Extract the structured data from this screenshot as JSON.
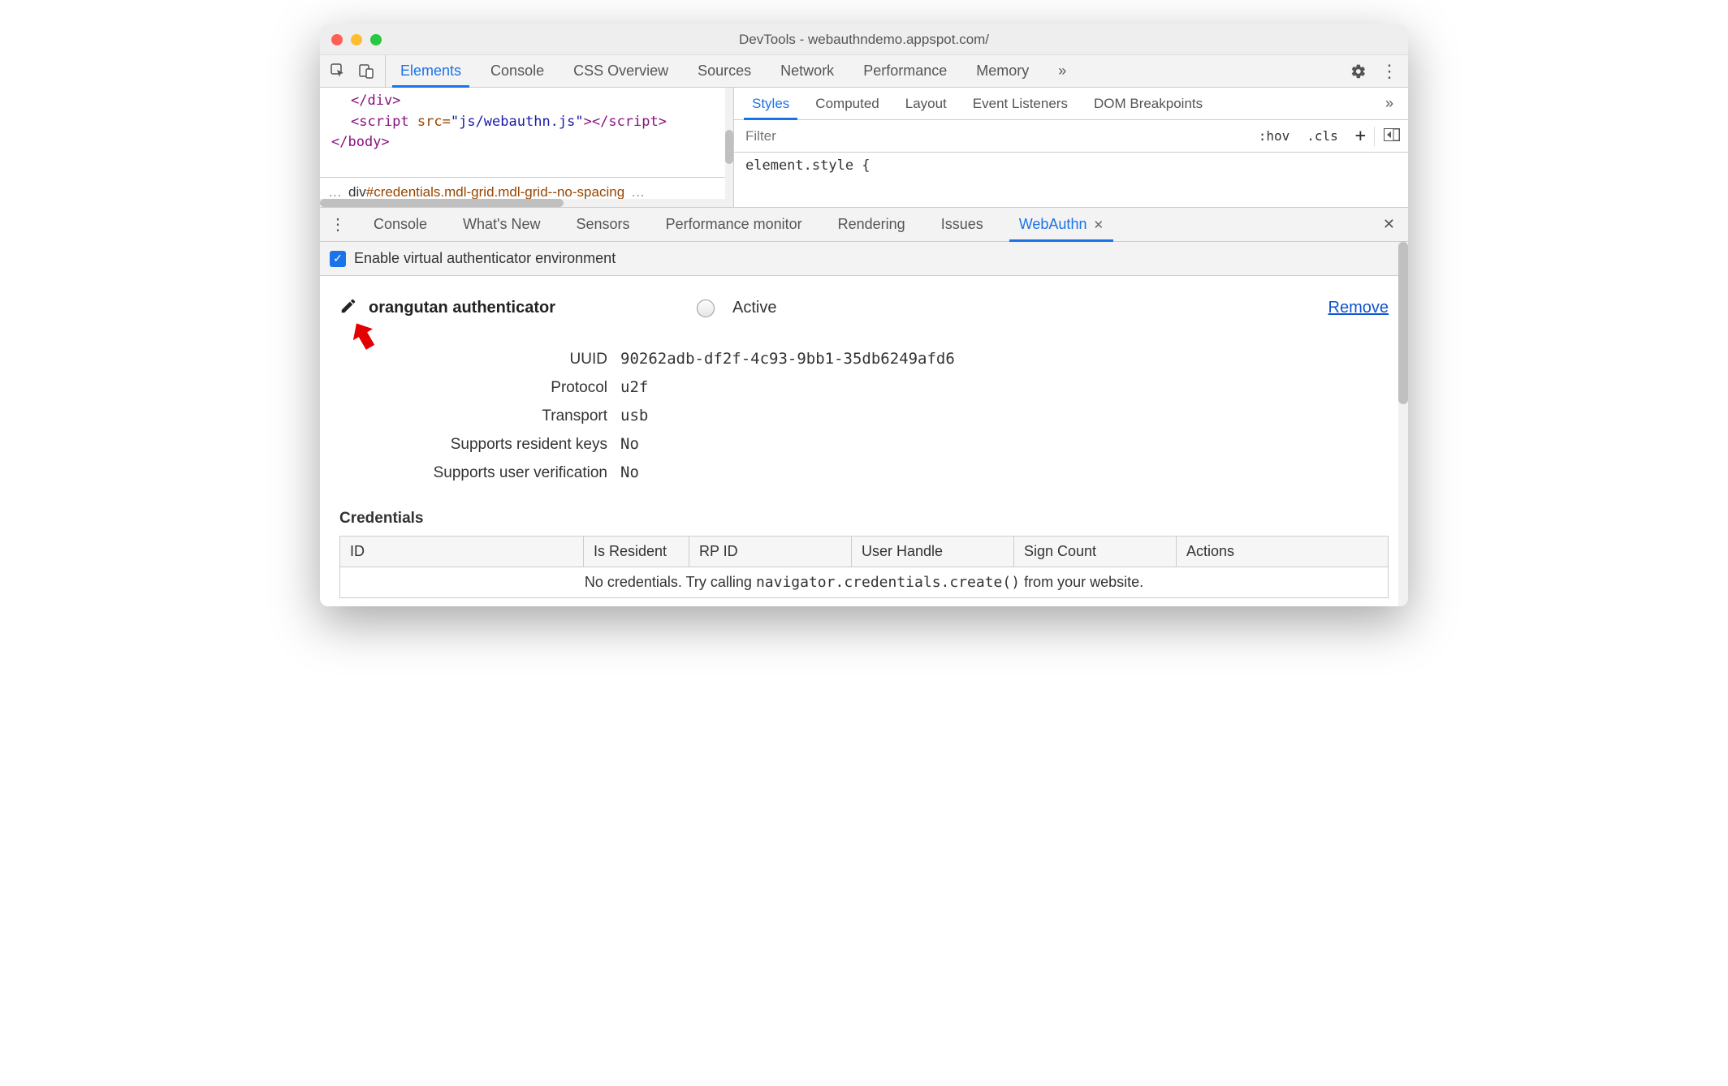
{
  "window": {
    "title": "DevTools - webauthndemo.appspot.com/"
  },
  "main_tabs": {
    "items": [
      "Elements",
      "Console",
      "CSS Overview",
      "Sources",
      "Network",
      "Performance",
      "Memory"
    ],
    "active_index": 0,
    "overflow_icon": "»"
  },
  "toolbar_icons": {
    "gear": "gear",
    "kebab": "⋮"
  },
  "code_snippet": {
    "line1_close": "</div>",
    "line2_open": "<script",
    "line2_attr": "src=",
    "line2_val": "\"js/webauthn.js\"",
    "line2_close": "></script>",
    "line3": "</body>"
  },
  "breadcrumb": {
    "left_dots": "…",
    "text_plain": "div",
    "id": "#credentials",
    "classes": ".mdl-grid.mdl-grid--no-spacing",
    "right_dots": "…"
  },
  "side_tabs": {
    "items": [
      "Styles",
      "Computed",
      "Layout",
      "Event Listeners",
      "DOM Breakpoints"
    ],
    "active_index": 0,
    "overflow_icon": "»"
  },
  "styles_filter": {
    "placeholder": "Filter",
    "hov": ":hov",
    "cls": ".cls",
    "plus": "+"
  },
  "styles_body": "element.style {",
  "drawer_tabs": {
    "items": [
      "Console",
      "What's New",
      "Sensors",
      "Performance monitor",
      "Rendering",
      "Issues",
      "WebAuthn"
    ],
    "active_index": 6
  },
  "enable_checkbox": {
    "checked": true,
    "label": "Enable virtual authenticator environment"
  },
  "authenticator": {
    "name": "orangutan authenticator",
    "active_label": "Active",
    "remove_label": "Remove",
    "props": {
      "uuid_label": "UUID",
      "uuid": "90262adb-df2f-4c93-9bb1-35db6249afd6",
      "protocol_label": "Protocol",
      "protocol": "u2f",
      "transport_label": "Transport",
      "transport": "usb",
      "resident_label": "Supports resident keys",
      "resident": "No",
      "uv_label": "Supports user verification",
      "uv": "No"
    }
  },
  "credentials": {
    "title": "Credentials",
    "columns": [
      "ID",
      "Is Resident",
      "RP ID",
      "User Handle",
      "Sign Count",
      "Actions"
    ],
    "empty_prefix": "No credentials. Try calling ",
    "empty_code": "navigator.credentials.create()",
    "empty_suffix": " from your website."
  }
}
